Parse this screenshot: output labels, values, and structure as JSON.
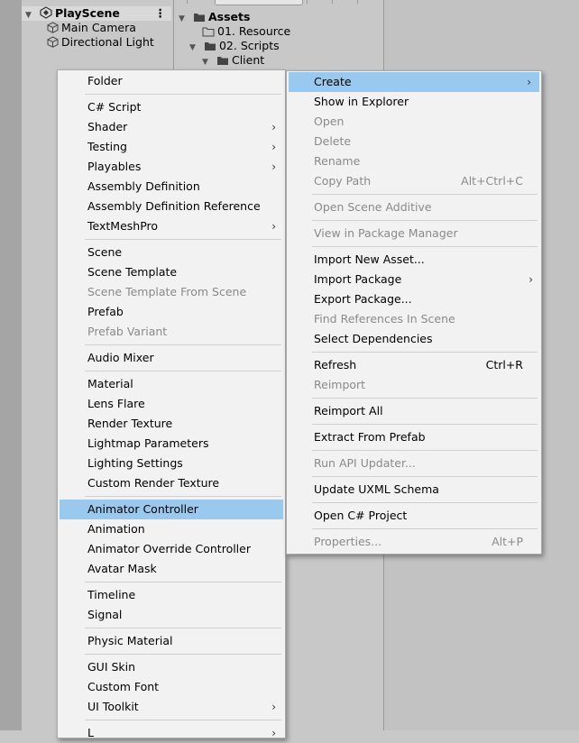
{
  "hierarchy": {
    "scene_name": "PlayScene",
    "kebab": "⋮",
    "objects": [
      "Main Camera",
      "Directional Light"
    ]
  },
  "project": {
    "root": "Assets",
    "folders": [
      "01. Resource",
      "02. Scripts",
      "Client"
    ]
  },
  "create_menu": {
    "items": [
      {
        "label": "Folder"
      },
      {
        "label": "C# Script"
      },
      {
        "label": "Shader",
        "submenu": "›"
      },
      {
        "label": "Testing",
        "submenu": "›"
      },
      {
        "label": "Playables",
        "submenu": "›"
      },
      {
        "label": "Assembly Definition"
      },
      {
        "label": "Assembly Definition Reference"
      },
      {
        "label": "TextMeshPro",
        "submenu": "›"
      },
      {
        "label": "Scene"
      },
      {
        "label": "Scene Template"
      },
      {
        "label": "Scene Template From Scene",
        "disabled": true
      },
      {
        "label": "Prefab"
      },
      {
        "label": "Prefab Variant",
        "disabled": true
      },
      {
        "label": "Audio Mixer"
      },
      {
        "label": "Material"
      },
      {
        "label": "Lens Flare"
      },
      {
        "label": "Render Texture"
      },
      {
        "label": "Lightmap Parameters"
      },
      {
        "label": "Lighting Settings"
      },
      {
        "label": "Custom Render Texture"
      },
      {
        "label": "Animator Controller",
        "highlighted": true
      },
      {
        "label": "Animation"
      },
      {
        "label": "Animator Override Controller"
      },
      {
        "label": "Avatar Mask"
      },
      {
        "label": "Timeline"
      },
      {
        "label": "Signal"
      },
      {
        "label": "Physic Material"
      },
      {
        "label": "GUI Skin"
      },
      {
        "label": "Custom Font"
      },
      {
        "label": "UI Toolkit",
        "submenu": "›"
      },
      {
        "label": "L",
        "submenu": "›"
      }
    ]
  },
  "context_menu": {
    "items": [
      {
        "label": "Create",
        "submenu": "›",
        "highlighted": true
      },
      {
        "label": "Show in Explorer"
      },
      {
        "label": "Open",
        "disabled": true
      },
      {
        "label": "Delete",
        "disabled": true
      },
      {
        "label": "Rename",
        "disabled": true
      },
      {
        "label": "Copy Path",
        "shortcut": "Alt+Ctrl+C",
        "disabled": true
      },
      {
        "label": "Open Scene Additive",
        "disabled": true
      },
      {
        "label": "View in Package Manager",
        "disabled": true
      },
      {
        "label": "Import New Asset..."
      },
      {
        "label": "Import Package",
        "submenu": "›"
      },
      {
        "label": "Export Package..."
      },
      {
        "label": "Find References In Scene",
        "disabled": true
      },
      {
        "label": "Select Dependencies"
      },
      {
        "label": "Refresh",
        "shortcut": "Ctrl+R"
      },
      {
        "label": "Reimport",
        "disabled": true
      },
      {
        "label": "Reimport All"
      },
      {
        "label": "Extract From Prefab"
      },
      {
        "label": "Run API Updater...",
        "disabled": true
      },
      {
        "label": "Update UXML Schema"
      },
      {
        "label": "Open C# Project"
      },
      {
        "label": "Properties...",
        "shortcut": "Alt+P",
        "disabled": true
      }
    ]
  },
  "colors": {
    "highlight": "#99c9ef",
    "menu_bg": "#f2f2f2",
    "disabled_text": "#8a8a8a",
    "editor_bg": "#c8c8c8"
  },
  "icons": {
    "scene": "unity-scene-icon",
    "gameobject": "cube-icon",
    "folder": "folder-icon",
    "folder_open": "folder-open-icon",
    "submenu": "chevron-right-icon"
  }
}
